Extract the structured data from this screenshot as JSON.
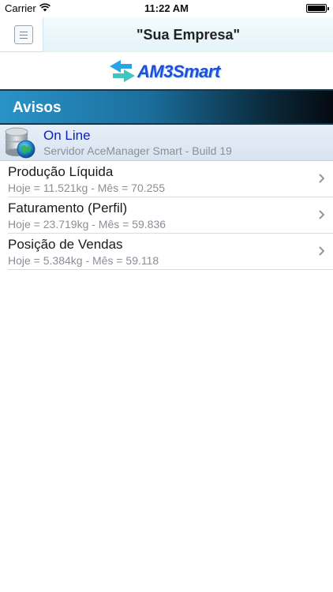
{
  "status_bar": {
    "carrier": "Carrier",
    "time": "11:22 AM"
  },
  "nav": {
    "title": "\"Sua Empresa\"",
    "menu_icon": "hamburger-icon"
  },
  "logo": {
    "text": "AM3Smart"
  },
  "section": {
    "title": "Avisos"
  },
  "status": {
    "title": "On Line",
    "subtitle": "Servidor AceManager Smart - Build 19",
    "icon": "database-globe-icon"
  },
  "items": [
    {
      "title": "Produção Líquida",
      "subtitle": "Hoje = 11.521kg - Mês = 70.255"
    },
    {
      "title": "Faturamento (Perfil)",
      "subtitle": "Hoje = 23.719kg - Mês = 59.836"
    },
    {
      "title": "Posição de Vendas",
      "subtitle": "Hoje = 5.384kg - Mês = 59.118"
    }
  ],
  "colors": {
    "accent_blue": "#0c1fb8",
    "header_gradient_start": "#2a93c8",
    "header_gradient_end": "#050a10"
  }
}
